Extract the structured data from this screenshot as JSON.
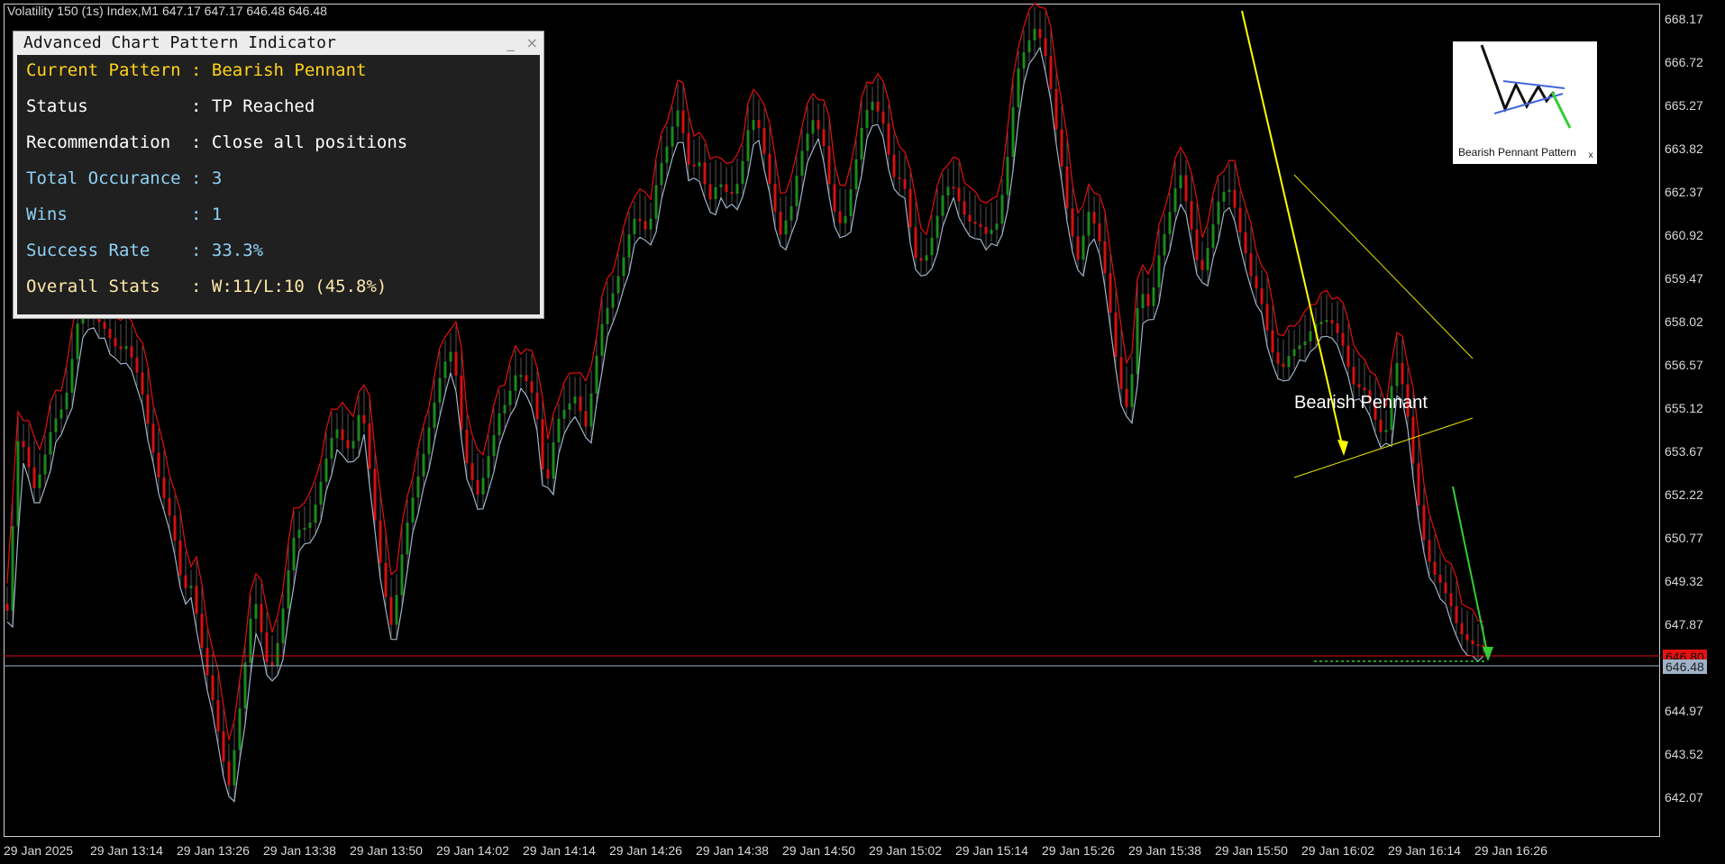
{
  "chart": {
    "title": "Volatility 150 (1s) Index,M1  647.17 647.17 646.48 646.48",
    "price_labels": [
      "668.17",
      "666.72",
      "665.27",
      "663.82",
      "662.37",
      "660.92",
      "659.47",
      "658.02",
      "656.57",
      "655.12",
      "653.67",
      "652.22",
      "650.77",
      "649.32",
      "647.87",
      "646.80",
      "646.48",
      "644.97",
      "643.52",
      "642.07"
    ],
    "time_labels": [
      "29 Jan 2025",
      "29 Jan 13:14",
      "29 Jan 13:26",
      "29 Jan 13:38",
      "29 Jan 13:50",
      "29 Jan 14:02",
      "29 Jan 14:14",
      "29 Jan 14:26",
      "29 Jan 14:38",
      "29 Jan 14:50",
      "29 Jan 15:02",
      "29 Jan 15:14",
      "29 Jan 15:26",
      "29 Jan 15:38",
      "29 Jan 15:50",
      "29 Jan 16:02",
      "29 Jan 16:14",
      "29 Jan 16:26"
    ],
    "ask_price": "646.80",
    "bid_price": "646.48",
    "pattern_label": "Bearish Pennant",
    "colors": {
      "bull": "#1a8a1a",
      "bear": "#d51010",
      "envelope_up": "#e41010",
      "envelope_dn": "#9fb3c8",
      "flagpole": "#ffff00",
      "pennant": "#e6e600",
      "tp_arrow": "#33cc33"
    }
  },
  "panel": {
    "title": "Advanced Chart Pattern Indicator",
    "minimize": "_",
    "close": "×",
    "rows": [
      {
        "text": "Current Pattern : Bearish Pennant",
        "color": "#ffd21a"
      },
      {
        "text": "Status          : TP Reached",
        "color": "#ffffff"
      },
      {
        "text": "Recommendation  : Close all positions",
        "color": "#ffffff"
      },
      {
        "text": "Total Occurance : 3",
        "color": "#8fd1f4"
      },
      {
        "text": "Wins            : 1",
        "color": "#8fd1f4"
      },
      {
        "text": "Success Rate    : 33.3%",
        "color": "#8fd1f4"
      },
      {
        "text": "Overall Stats   : W:11/L:10 (45.8%)",
        "color": "#ffe9a8"
      }
    ]
  },
  "thumbnail": {
    "caption": "Bearish Pennant Pattern",
    "close": "x",
    "icon": "bearish-pennant-diagram-icon"
  }
}
